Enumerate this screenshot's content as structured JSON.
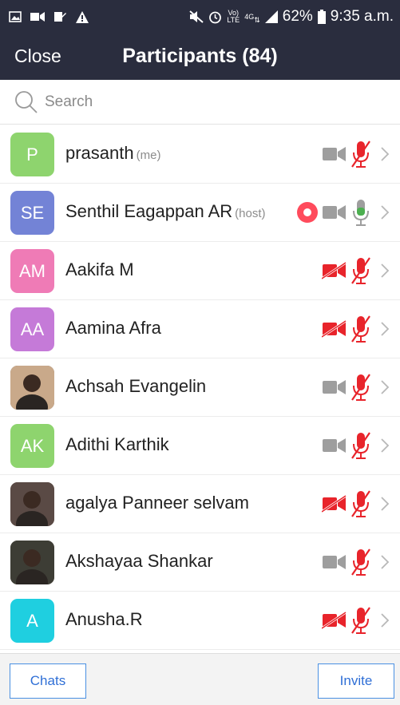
{
  "status_bar": {
    "battery_percent": "62%",
    "time": "9:35 a.m.",
    "volte_label": "Vo)\nLTE",
    "network_label": "4G"
  },
  "header": {
    "close_label": "Close",
    "title": "Participants (84)"
  },
  "search": {
    "placeholder": "Search"
  },
  "participants": [
    {
      "initials": "P",
      "name": "prasanth",
      "tag": "(me)",
      "avatar_color": "#8ed46e",
      "avatar_type": "initials",
      "recording": false,
      "video": "off-gray",
      "audio": "muted"
    },
    {
      "initials": "SE",
      "name": "Senthil Eagappan AR",
      "tag": "(host)",
      "avatar_color": "#7383d6",
      "avatar_type": "initials",
      "recording": true,
      "video": "off-gray",
      "audio": "on"
    },
    {
      "initials": "AM",
      "name": "Aakifa M",
      "tag": "",
      "avatar_color": "#ef7bb6",
      "avatar_type": "initials",
      "recording": false,
      "video": "off-red",
      "audio": "muted"
    },
    {
      "initials": "AA",
      "name": "Aamina Afra",
      "tag": "",
      "avatar_color": "#c57ad8",
      "avatar_type": "initials",
      "recording": false,
      "video": "off-red",
      "audio": "muted"
    },
    {
      "initials": "",
      "name": "Achsah Evangelin",
      "tag": "",
      "avatar_color": "#c9a98a",
      "avatar_type": "photo",
      "recording": false,
      "video": "off-gray",
      "audio": "muted"
    },
    {
      "initials": "AK",
      "name": "Adithi Karthik",
      "tag": "",
      "avatar_color": "#8ed46e",
      "avatar_type": "initials",
      "recording": false,
      "video": "off-gray",
      "audio": "muted"
    },
    {
      "initials": "",
      "name": "agalya Panneer selvam",
      "tag": "",
      "avatar_color": "#5a4a45",
      "avatar_type": "photo",
      "recording": false,
      "video": "off-red",
      "audio": "muted"
    },
    {
      "initials": "",
      "name": "Akshayaa Shankar",
      "tag": "",
      "avatar_color": "#3d3d35",
      "avatar_type": "photo",
      "recording": false,
      "video": "off-gray",
      "audio": "muted"
    },
    {
      "initials": "A",
      "name": "Anusha.R",
      "tag": "",
      "avatar_color": "#1fcfe0",
      "avatar_type": "initials",
      "recording": false,
      "video": "off-red",
      "audio": "muted"
    }
  ],
  "footer": {
    "chats_label": "Chats",
    "invite_label": "Invite"
  },
  "colors": {
    "header_bg": "#2a2d3e",
    "muted_red": "#e8242b",
    "mic_on_green": "#4caf50",
    "cam_gray": "#9e9e9e",
    "accent_blue": "#4a90e2"
  }
}
